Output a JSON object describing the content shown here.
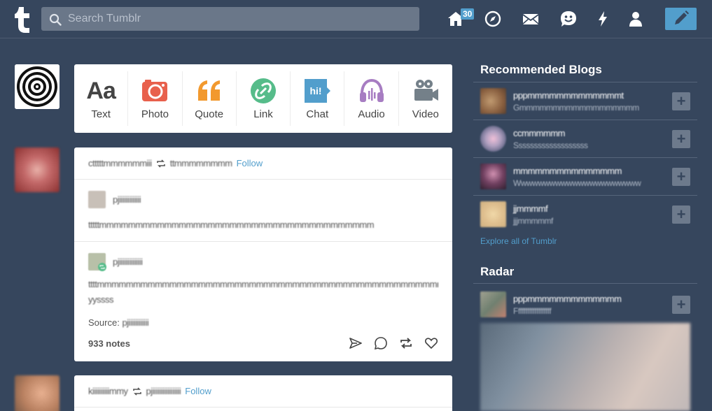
{
  "header": {
    "search_placeholder": "Search Tumblr",
    "home_badge": "30",
    "nav_icons": [
      "home-icon",
      "compass-icon",
      "mail-icon",
      "smiley-icon",
      "lightning-icon",
      "account-icon"
    ],
    "compose_icon": "pencil-icon"
  },
  "post_bar": {
    "items": [
      {
        "label": "Text",
        "glyph": "Aa",
        "color": "#444444"
      },
      {
        "label": "Photo",
        "color": "#ff492f"
      },
      {
        "label": "Quote",
        "glyph": "“",
        "color": "#ff8a00"
      },
      {
        "label": "Link",
        "color": "#00cf35"
      },
      {
        "label": "Chat",
        "glyph": "hi!",
        "color": "#00b8ff"
      },
      {
        "label": "Audio",
        "color": "#7c5cff"
      },
      {
        "label": "Video",
        "color": "#748089"
      }
    ]
  },
  "post1": {
    "author": "ctttttmmmmmmiii",
    "reblogged_from": "ttmmmmmmmm",
    "follow_label": "Follow",
    "reblog1": {
      "name": "pjiiiiiiiiiiiii",
      "text": "tttttmmmmmmmmmmmmmmmmmmmmmmmmmmmmmmmmmmmmmm"
    },
    "reblog2": {
      "name": "pjiiiiiiiiiiiiii",
      "text": "ttttmmmmmmmmmmmmmmmmmmmmmmmmmmmmmmmmmmmmmmmmmmmmmmmmmmmmmmmmmmmmmmmmmmm",
      "text2": "yyssss",
      "source_label": "Source:",
      "source_value": "pjiiiiiiiiiiii"
    },
    "notes": "933 notes"
  },
  "post2": {
    "author": "kiiiiiiiiiimmy",
    "reblogged_from": "pjiiiiiiiiiiiiiiiii",
    "follow_label": "Follow"
  },
  "sidebar": {
    "recommended_title": "Recommended Blogs",
    "blogs": [
      {
        "name": "pppmmmmmmmmmmmmmt",
        "desc": "Gmmmmmmmmmmmmmmmmmm"
      },
      {
        "name": "ccmmmmmm",
        "desc": "Sssssssssssssssssss"
      },
      {
        "name": "mmmmmmmmmmmmmmm",
        "desc": "Wwwwwwwwwwwwwwwwwwwwww"
      },
      {
        "name": "jjmmmmf",
        "desc": "jjjmmmmmf"
      }
    ],
    "explore_label": "Explore all of Tumblr",
    "radar_title": "Radar",
    "radar_blog": {
      "name": "pppmmmmmmmmmmmmm",
      "desc": "Fffffffffffffffffff"
    }
  }
}
